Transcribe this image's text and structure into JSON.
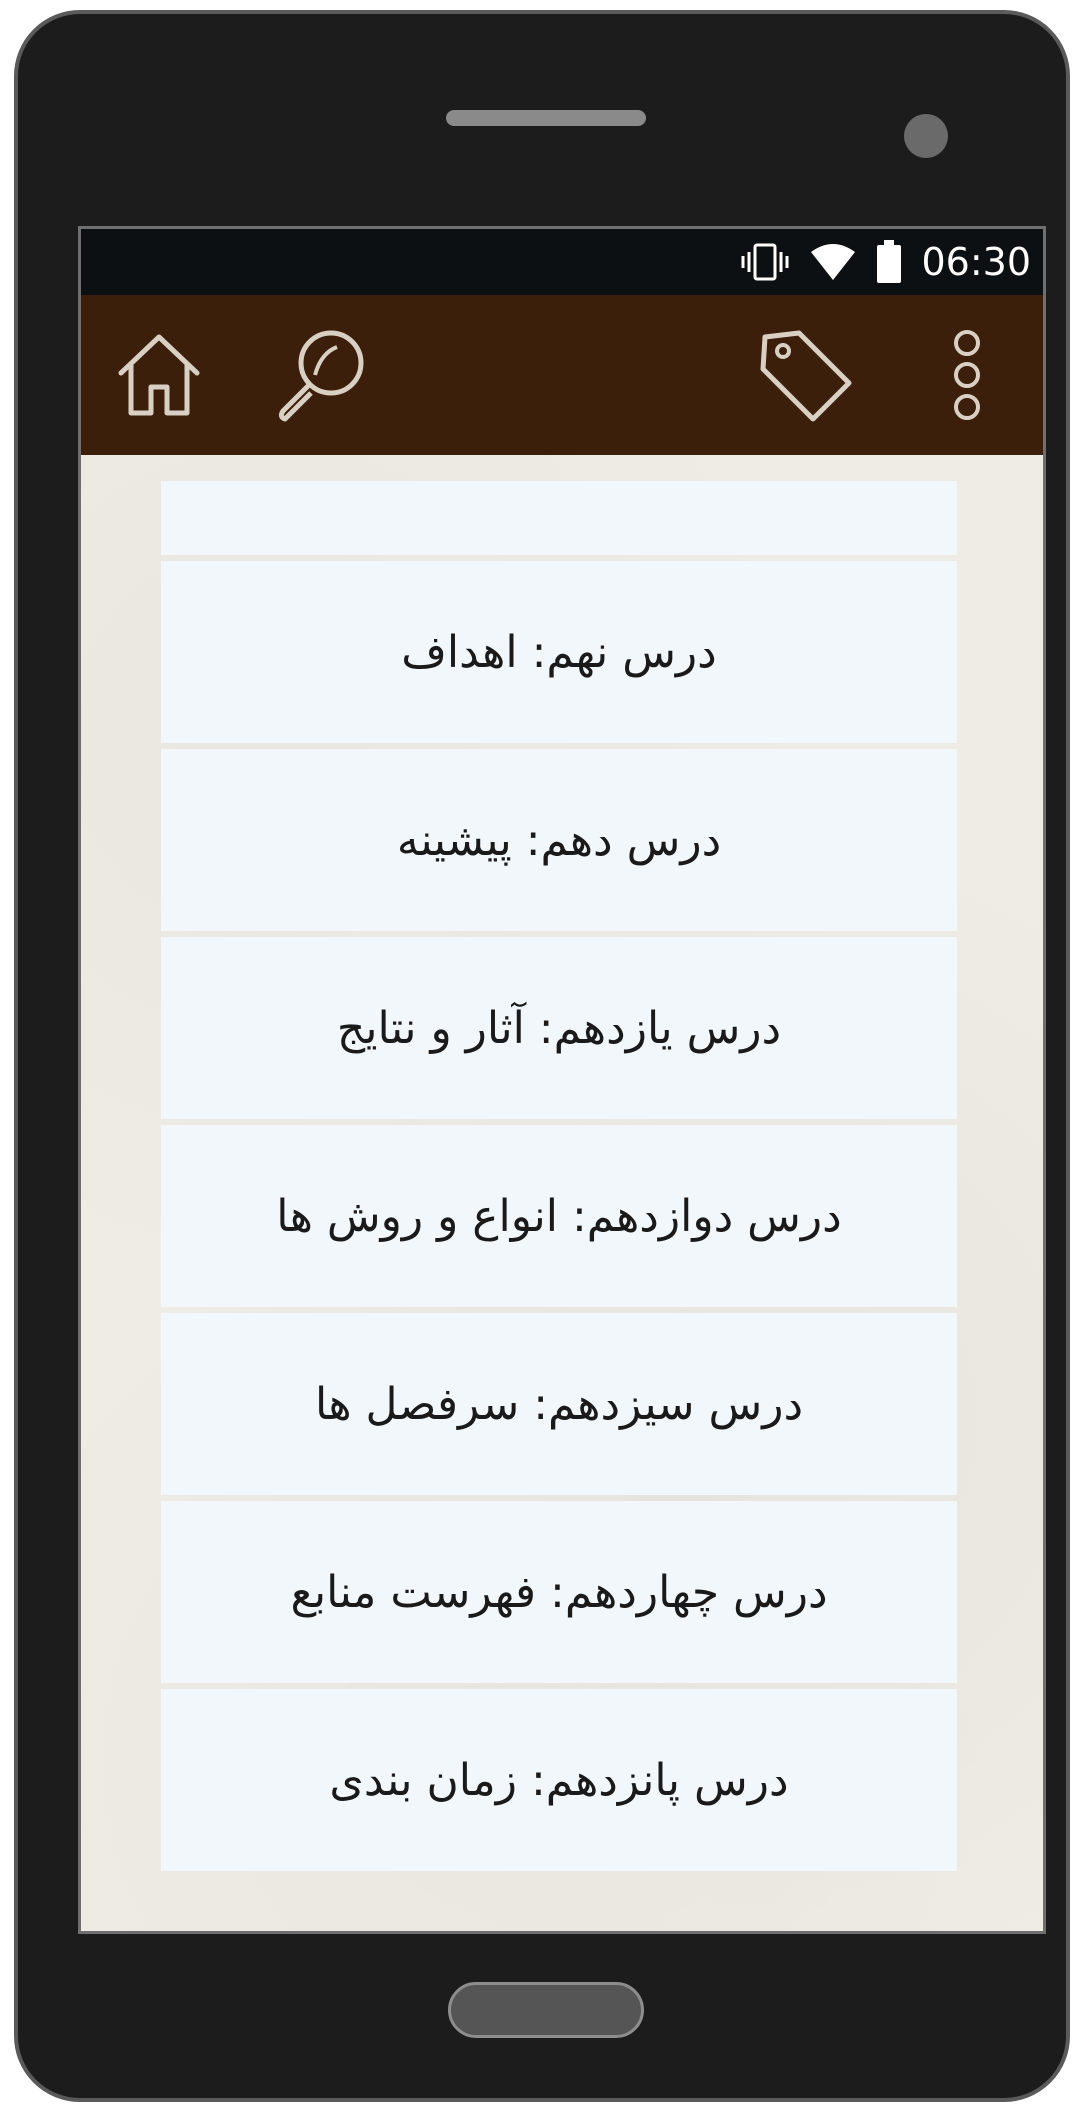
{
  "status_bar": {
    "time": "06:30",
    "icons": [
      "vibrate-icon",
      "wifi-icon",
      "battery-icon"
    ]
  },
  "app_bar": {
    "left_icons": [
      "home-icon",
      "search-icon"
    ],
    "right_icons": [
      "tag-icon",
      "more-vert-icon"
    ],
    "icon_color": "#d9d0c3",
    "background": "#3b1f0a"
  },
  "lessons": [
    {
      "label": "درس نهم: اهداف"
    },
    {
      "label": "درس دهم: پیشینه"
    },
    {
      "label": "درس یازدهم: آثار و نتایج"
    },
    {
      "label": "درس دوازدهم: انواع و روش ها"
    },
    {
      "label": "درس سیزدهم: سرفصل ها"
    },
    {
      "label": "درس چهاردهم: فهرست منابع"
    },
    {
      "label": "درس پانزدهم: زمان بندی"
    }
  ],
  "colors": {
    "list_item_bg": "#f2f7fb",
    "screen_bg": "#efece5"
  }
}
